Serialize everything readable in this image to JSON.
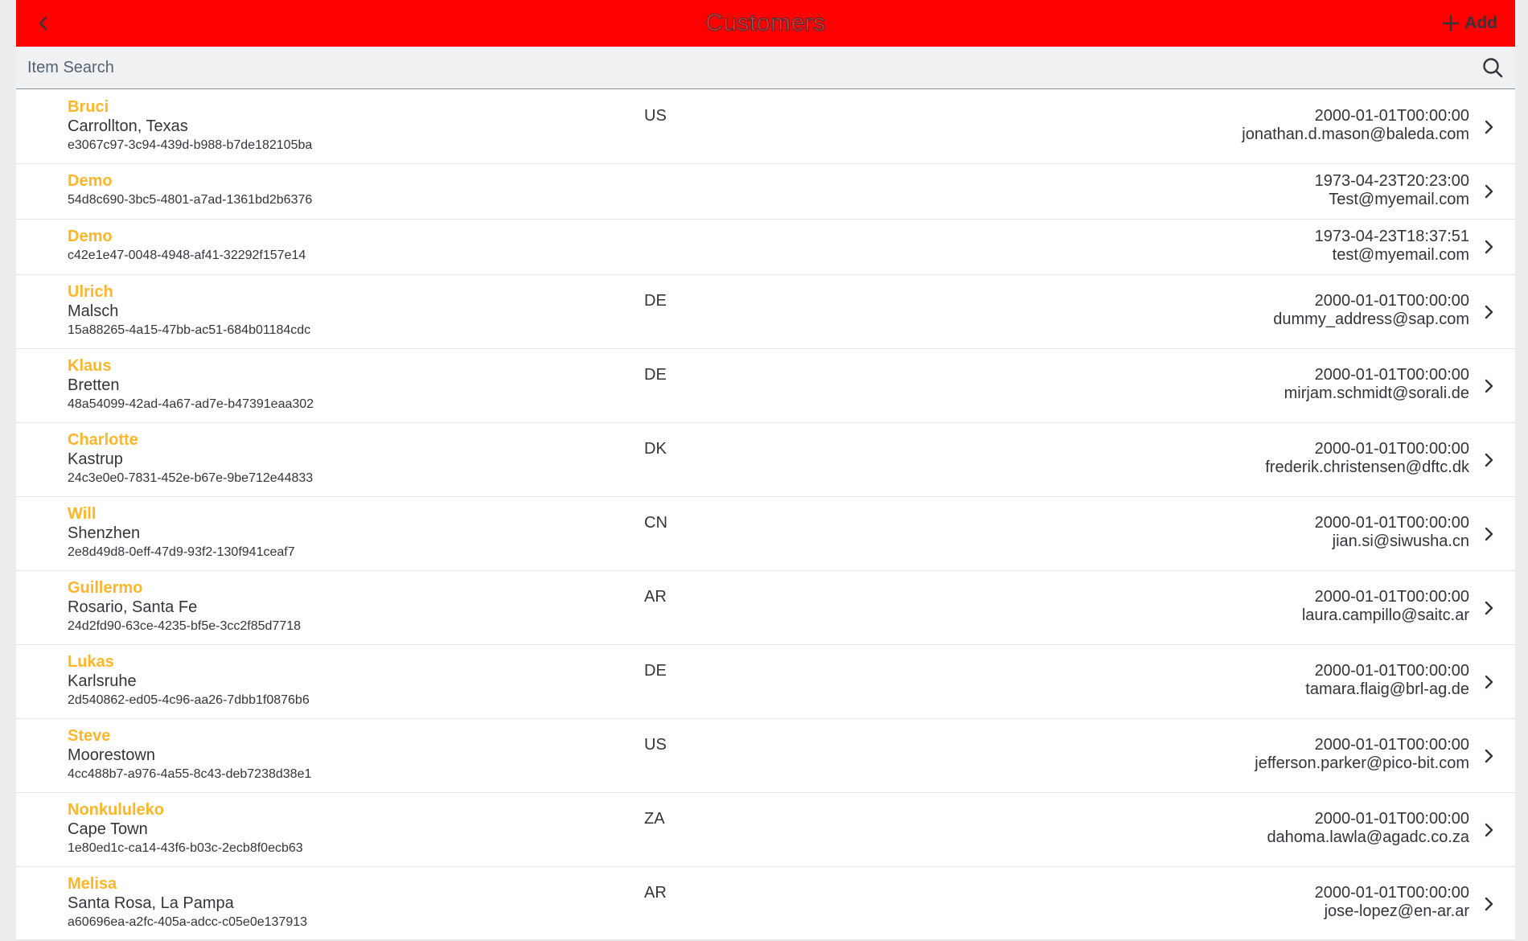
{
  "header": {
    "title": "Customers",
    "add_label": "Add"
  },
  "search": {
    "placeholder": "Item Search"
  },
  "colors": {
    "header_bg": "#ff0000",
    "name": "#fdb627",
    "text": "#32363a"
  },
  "icons": {
    "back": "chevron-left-icon",
    "add": "plus-icon",
    "search": "search-icon",
    "row_nav": "chevron-right-icon"
  },
  "customers": [
    {
      "name": "Bruci",
      "city": "Carrollton, Texas",
      "id": "e3067c97-3c94-439d-b988-b7de182105ba",
      "country": "US",
      "date": "2000-01-01T00:00:00",
      "email": "jonathan.d.mason@baleda.com"
    },
    {
      "name": "Demo",
      "city": "",
      "id": "54d8c690-3bc5-4801-a7ad-1361bd2b6376",
      "country": "",
      "date": "1973-04-23T20:23:00",
      "email": "Test@myemail.com"
    },
    {
      "name": "Demo",
      "city": "",
      "id": "c42e1e47-0048-4948-af41-32292f157e14",
      "country": "",
      "date": "1973-04-23T18:37:51",
      "email": "test@myemail.com"
    },
    {
      "name": "Ulrich",
      "city": "Malsch",
      "id": "15a88265-4a15-47bb-ac51-684b01184cdc",
      "country": "DE",
      "date": "2000-01-01T00:00:00",
      "email": "dummy_address@sap.com"
    },
    {
      "name": "Klaus",
      "city": "Bretten",
      "id": "48a54099-42ad-4a67-ad7e-b47391eaa302",
      "country": "DE",
      "date": "2000-01-01T00:00:00",
      "email": "mirjam.schmidt@sorali.de"
    },
    {
      "name": "Charlotte",
      "city": "Kastrup",
      "id": "24c3e0e0-7831-452e-b67e-9be712e44833",
      "country": "DK",
      "date": "2000-01-01T00:00:00",
      "email": "frederik.christensen@dftc.dk"
    },
    {
      "name": "Will",
      "city": "Shenzhen",
      "id": "2e8d49d8-0eff-47d9-93f2-130f941ceaf7",
      "country": "CN",
      "date": "2000-01-01T00:00:00",
      "email": "jian.si@siwusha.cn"
    },
    {
      "name": "Guillermo",
      "city": "Rosario, Santa Fe",
      "id": "24d2fd90-63ce-4235-bf5e-3cc2f85d7718",
      "country": "AR",
      "date": "2000-01-01T00:00:00",
      "email": "laura.campillo@saitc.ar"
    },
    {
      "name": "Lukas",
      "city": "Karlsruhe",
      "id": "2d540862-ed05-4c96-aa26-7dbb1f0876b6",
      "country": "DE",
      "date": "2000-01-01T00:00:00",
      "email": "tamara.flaig@brl-ag.de"
    },
    {
      "name": "Steve",
      "city": "Moorestown",
      "id": "4cc488b7-a976-4a55-8c43-deb7238d38e1",
      "country": "US",
      "date": "2000-01-01T00:00:00",
      "email": "jefferson.parker@pico-bit.com"
    },
    {
      "name": "Nonkululeko",
      "city": "Cape Town",
      "id": "1e80ed1c-ca14-43f6-b03c-2ecb8f0ecb63",
      "country": "ZA",
      "date": "2000-01-01T00:00:00",
      "email": "dahoma.lawla@agadc.co.za"
    },
    {
      "name": "Melisa",
      "city": "Santa Rosa, La Pampa",
      "id": "a60696ea-a2fc-405a-adcc-c05e0e137913",
      "country": "AR",
      "date": "2000-01-01T00:00:00",
      "email": "jose-lopez@en-ar.ar"
    }
  ]
}
